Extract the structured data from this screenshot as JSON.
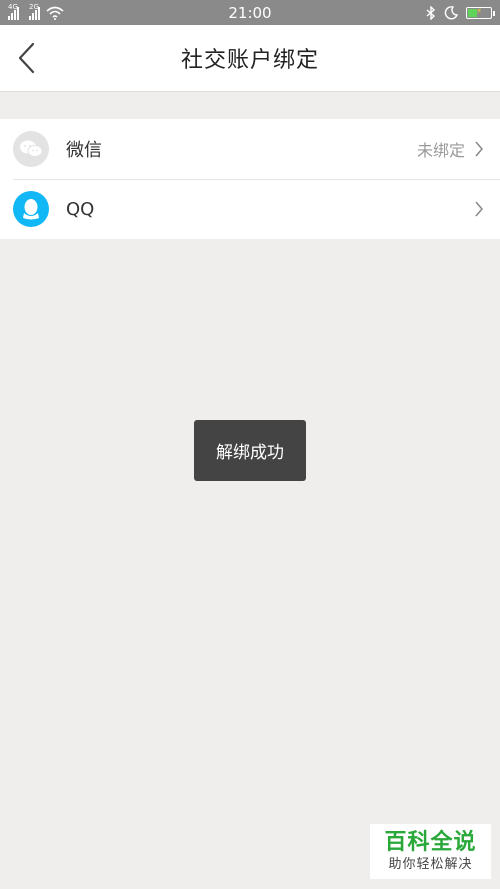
{
  "status_bar": {
    "time": "21:00",
    "network_1": "4G",
    "network_2": "2G"
  },
  "header": {
    "title": "社交账户绑定"
  },
  "accounts": [
    {
      "icon": "wechat-icon",
      "label": "微信",
      "status": "未绑定"
    },
    {
      "icon": "qq-icon",
      "label": "QQ",
      "status": ""
    }
  ],
  "toast": {
    "message": "解绑成功"
  },
  "watermark": {
    "title": "百科全说",
    "subtitle": "助你轻松解决"
  },
  "colors": {
    "background": "#efeeec",
    "qq_brand": "#12b7f5",
    "toast_bg": "#444444",
    "watermark_green": "#2aa839"
  }
}
